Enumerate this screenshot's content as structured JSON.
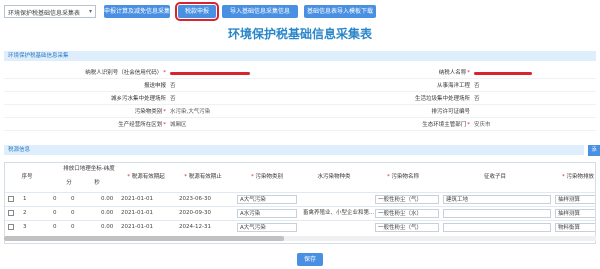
{
  "toolbar": {
    "select_value": "环境保护税基础信息采集表",
    "btn_submit_confirm": "申报计算及减免信息采集",
    "btn_report": "税款申报",
    "btn_import": "导入基础信息采集信息",
    "btn_download": "基础信息表导入模板下载"
  },
  "page_title": "环境保护税基础信息采集表",
  "section_basic": "环境保护税基础信息采集",
  "section_emission": "税源信息",
  "form": {
    "taxpayer_id_label": "纳税人识别号（社会信用代码）",
    "taxpayer_name_label": "纳税人名称",
    "declare_label": "报送申报",
    "declare_value": "否",
    "ocean_label": "从事海洋工程",
    "ocean_value": "否",
    "sewage_label": "城乡污水集中处理场所",
    "sewage_value": "否",
    "garbage_label": "生活垃圾集中处理场所",
    "garbage_value": "否",
    "pollutant_type_label": "污染物类别",
    "pollutant_type_value": "水污染,大气污染",
    "permit_label": "排污许可证编号",
    "permit_value": "",
    "region_label": "生产经营所在区划",
    "region_value": "城厢区",
    "eco_label": "生态环境主管部门",
    "eco_value": "安庆市"
  },
  "table": {
    "headers": {
      "no": "序号",
      "coord": "排放口地理坐标-纬度",
      "min": "分",
      "sec": "秒",
      "valid_start": "税源有效期起",
      "valid_end": "税源有效期止",
      "pollutant_cat": "污染物类别",
      "water_type": "水污染物种类",
      "pollutant_name": "污染物名称",
      "tax_item": "征收子目",
      "method": "污染物排放"
    },
    "rows": [
      {
        "no": "1",
        "deg": "0",
        "min": "0",
        "sec": "0.00",
        "start": "2021-01-01",
        "end": "2023-06-30",
        "cat": "A大气污染",
        "water": "",
        "name": "一般性粉尘（气）",
        "item": "建筑工地",
        "method": "抽样测算"
      },
      {
        "no": "2",
        "deg": "0",
        "min": "0",
        "sec": "0.00",
        "start": "2021-01-01",
        "end": "2020-09-30",
        "cat": "A水污染",
        "water": "畜禽养殖业、小型企业和第...",
        "name": "一般性粉尘（水）",
        "item": "",
        "method": "抽样测算"
      },
      {
        "no": "3",
        "deg": "0",
        "min": "0",
        "sec": "0.00",
        "start": "2021-01-01",
        "end": "2024-12-31",
        "cat": "A大气污染",
        "water": "",
        "name": "一般性粉尘（气）",
        "item": "",
        "method": "物料衡算"
      }
    ]
  },
  "save_label": "保存",
  "add_label": "添"
}
